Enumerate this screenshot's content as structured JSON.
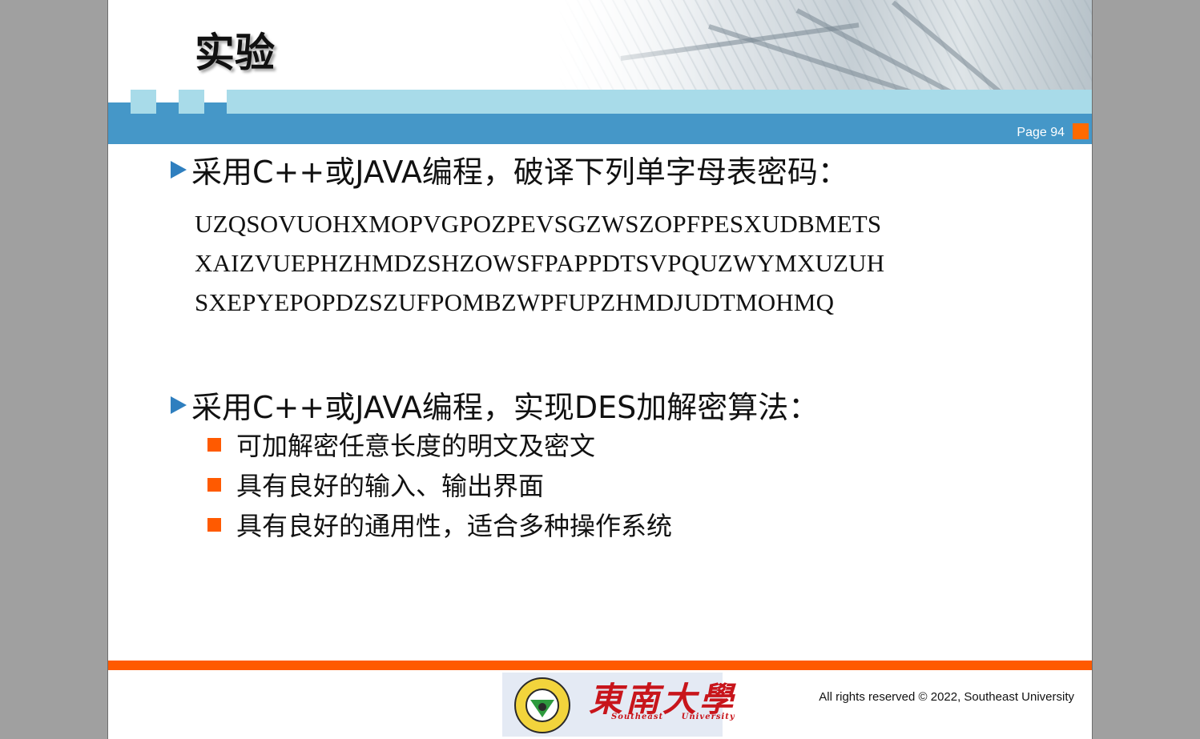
{
  "slide": {
    "title": "实验",
    "page_label": "Page 94"
  },
  "task1": {
    "heading": "采用C++或JAVA编程，破译下列单字母表密码：",
    "cipher_lines": [
      "UZQSOVUOHXMOPVGPOZPEVSGZWSZOPFPESXUDBMETS",
      "XAIZVUEPHZHMDZSHZOWSFPAPPDTSVPQUZWYMXUZUH",
      "SXEPYEPOPDZSZUFPOMBZWPFUPZHMDJUDTMOHMQ"
    ]
  },
  "task2": {
    "heading": "采用C++或JAVA编程，实现DES加解密算法：",
    "items": [
      "可加解密任意长度的明文及密文",
      "具有良好的输入、输出界面",
      "具有良好的通用性，适合多种操作系统"
    ]
  },
  "footer": {
    "logo_cn": "東南大學",
    "logo_en": "Southeast University",
    "copyright": "All rights reserved © 2022, Southeast University"
  },
  "colors": {
    "band_blue": "#4597c8",
    "light_blue": "#a8dbe9",
    "accent_orange": "#ff5a00",
    "bullet_triangle": "#2f7fbf"
  }
}
